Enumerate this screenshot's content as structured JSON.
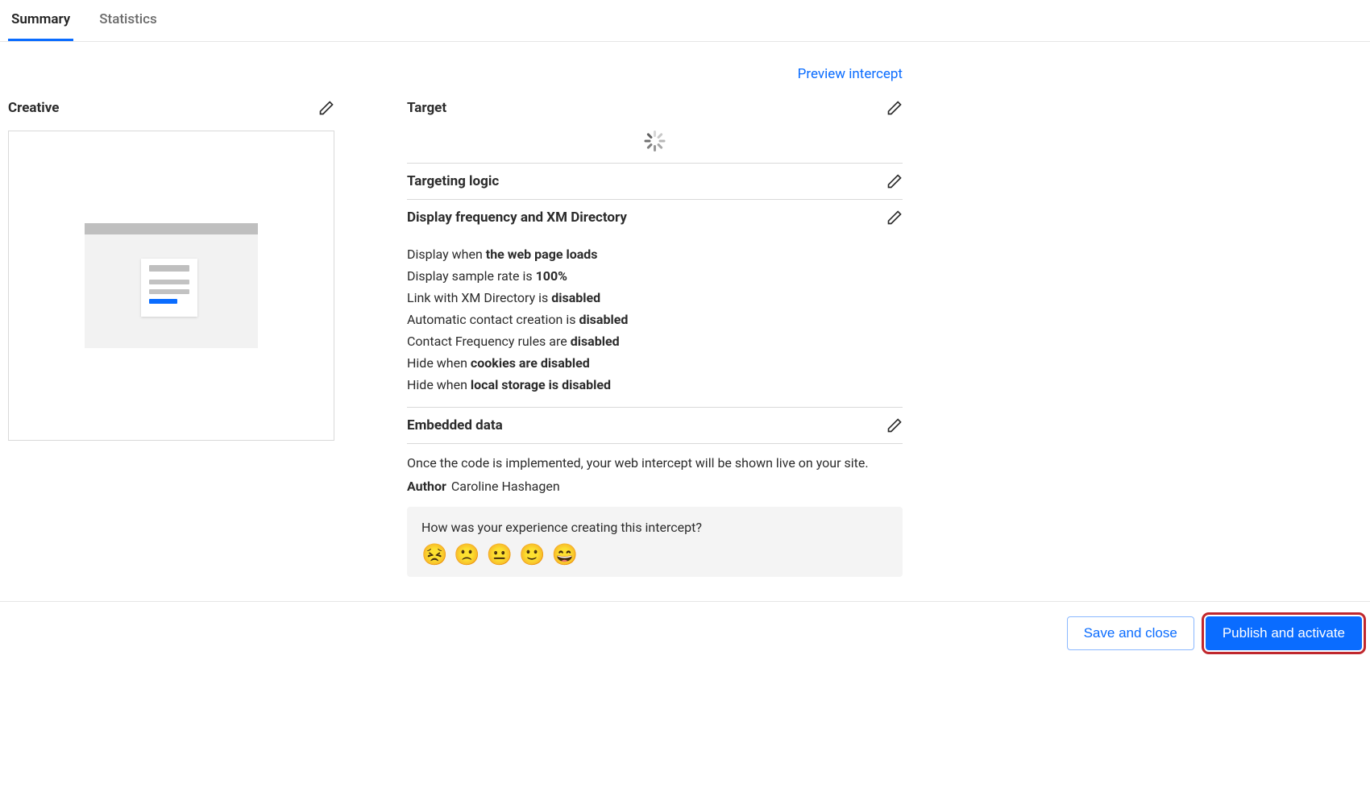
{
  "tabs": {
    "summary": "Summary",
    "statistics": "Statistics"
  },
  "previewLink": "Preview intercept",
  "creative": {
    "title": "Creative"
  },
  "target": {
    "title": "Target"
  },
  "targetingLogic": {
    "title": "Targeting logic"
  },
  "displayFreq": {
    "title": "Display frequency and XM Directory",
    "lines": {
      "displayWhen": {
        "pre": "Display when ",
        "bold": "the web page loads"
      },
      "sampleRate": {
        "pre": "Display sample rate is ",
        "bold": "100%"
      },
      "xmLink": {
        "pre": "Link with XM Directory is ",
        "bold": "disabled"
      },
      "autoContact": {
        "pre": "Automatic contact creation is ",
        "bold": "disabled"
      },
      "contactFreq": {
        "pre": "Contact Frequency rules are ",
        "bold": "disabled"
      },
      "hideCookies": {
        "pre": "Hide when ",
        "bold": "cookies are disabled"
      },
      "hideLocal": {
        "pre": "Hide when ",
        "bold": "local storage is disabled"
      }
    }
  },
  "embeddedData": {
    "title": "Embedded data"
  },
  "note": "Once the code is implemented, your web intercept will be shown live on your site.",
  "author": {
    "label": "Author",
    "name": "Caroline Hashagen"
  },
  "feedback": {
    "question": "How was your experience creating this intercept?",
    "emojis": {
      "veryBad": "😣",
      "bad": "🙁",
      "neutral": "😐",
      "good": "🙂",
      "great": "😄"
    }
  },
  "footer": {
    "save": "Save and close",
    "publish": "Publish and activate"
  }
}
